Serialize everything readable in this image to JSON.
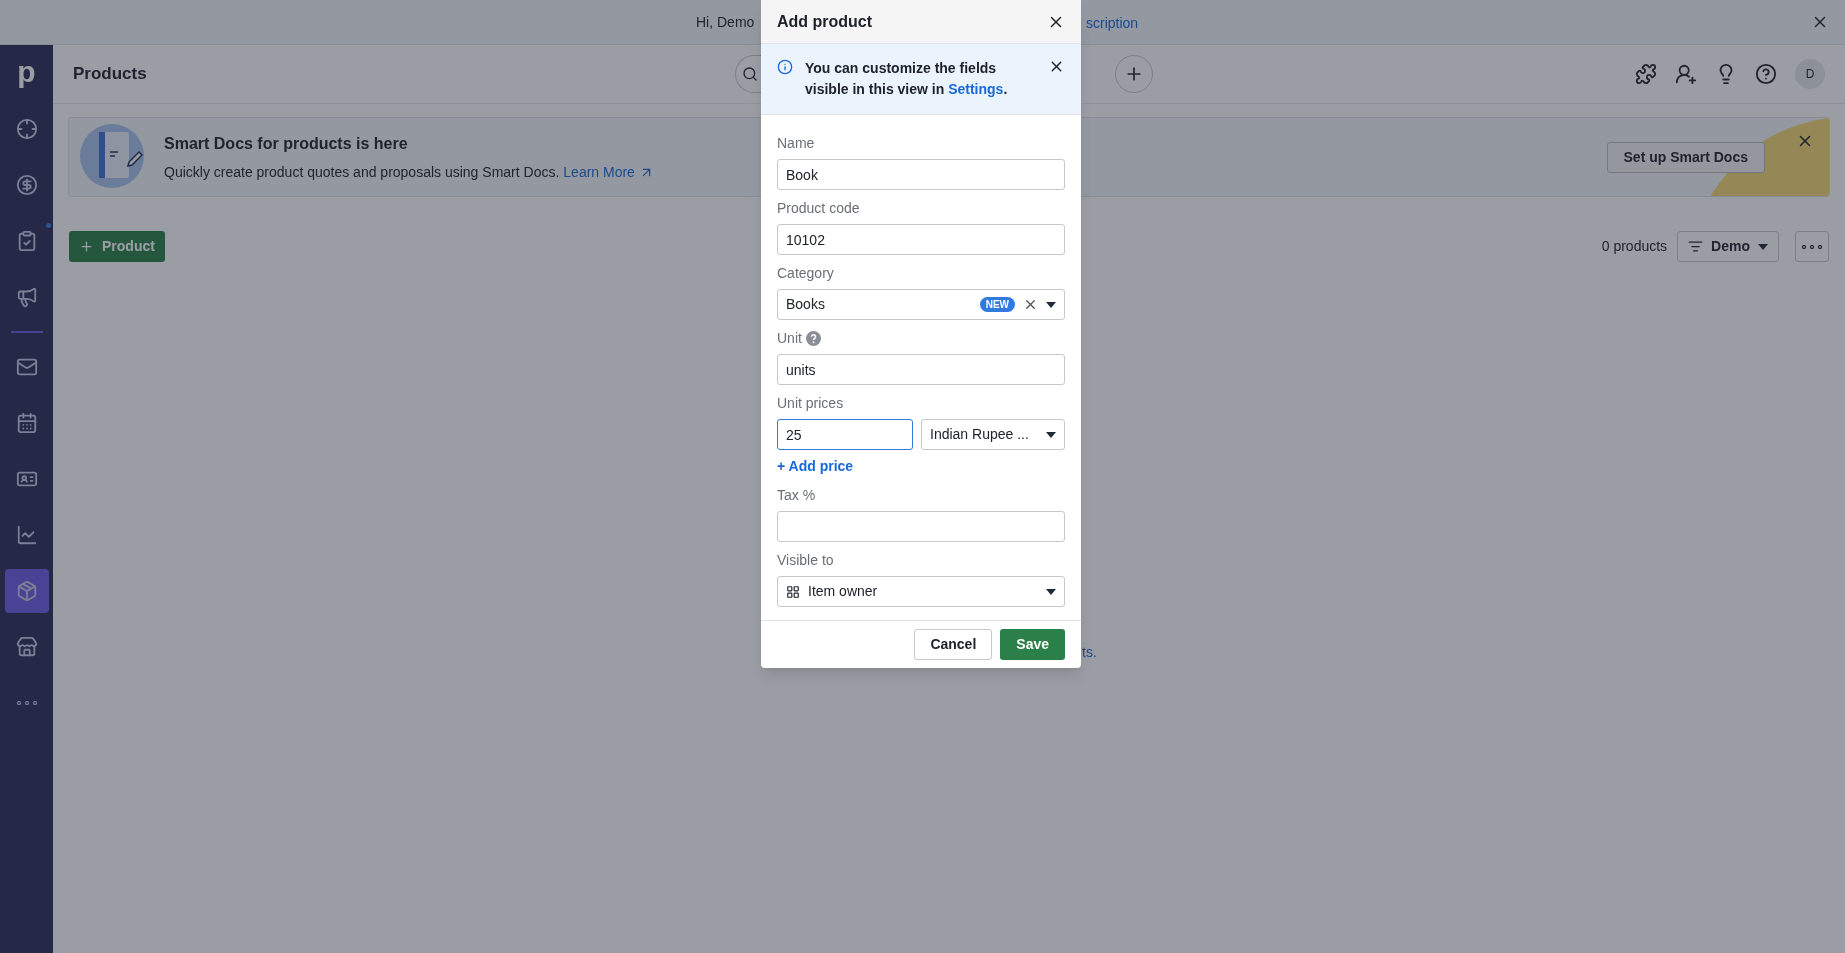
{
  "top_banner": {
    "greeting": "Hi, Demo",
    "link": "scription"
  },
  "sidebar": {
    "logo": "p",
    "items": [
      {
        "selected": false,
        "dot": false
      },
      {
        "selected": false,
        "dot": false
      },
      {
        "selected": false,
        "dot": true
      },
      {
        "selected": false,
        "dot": false
      },
      {
        "selected": false,
        "dot": false
      },
      {
        "selected": false,
        "dot": false
      },
      {
        "selected": false,
        "dot": false
      },
      {
        "selected": false,
        "dot": false
      },
      {
        "selected": true,
        "dot": false
      },
      {
        "selected": false,
        "dot": false
      },
      {
        "selected": false,
        "dot": false
      }
    ]
  },
  "header": {
    "title": "Products",
    "avatar": "D"
  },
  "promo": {
    "title": "Smart Docs for products is here",
    "text": "Quickly create product quotes and proposals using Smart Docs.",
    "link": "Learn More",
    "button": "Set up Smart Docs"
  },
  "toolbar": {
    "add_button": "Product",
    "count": "0 products",
    "filter": "Demo"
  },
  "empty_text": "ts.",
  "modal": {
    "title": "Add product",
    "notice": "You can customize the fields visible in this view in",
    "notice_link": "Settings",
    "notice_end": ".",
    "fields": [
      {
        "kind": "text",
        "label": "Name",
        "value": "Book",
        "focused": false,
        "help": false
      },
      {
        "kind": "text",
        "label": "Product code",
        "value": "10102",
        "focused": false,
        "help": false
      },
      {
        "kind": "category",
        "label": "Category",
        "value": "Books",
        "badge": "NEW",
        "help": false
      },
      {
        "kind": "text",
        "label": "Unit",
        "value": "units",
        "help": true,
        "focused": false
      },
      {
        "kind": "price",
        "label": "Unit prices",
        "value": "25",
        "focused": true,
        "currency": "Indian Rupee ...",
        "add_link": "+ Add price",
        "help": false
      },
      {
        "kind": "text",
        "label": "Tax %",
        "focused": false,
        "help": false
      },
      {
        "kind": "select",
        "label": "Visible to",
        "value": "Item owner",
        "help": false
      }
    ],
    "cancel": "Cancel",
    "save": "Save"
  }
}
